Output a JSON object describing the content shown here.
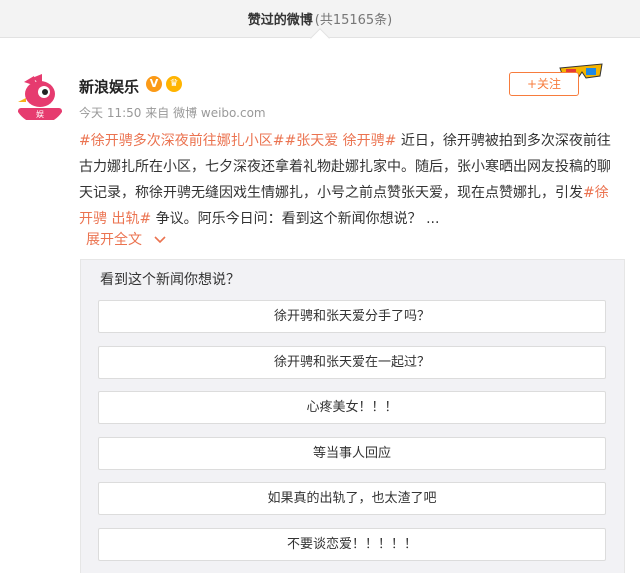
{
  "header": {
    "title": "赞过的微博",
    "count": "(共15165条)"
  },
  "post": {
    "author": "新浪娱乐",
    "verified_icon": "V",
    "time": "今天 11:50",
    "source_prefix": "来自",
    "source": "微博 weibo.com",
    "follow_label": "+关注",
    "topic1": "#徐开骋多次深夜前往娜扎小区#",
    "topic2": "#张天爱 徐开骋#",
    "text1": " 近日，徐开骋被拍到多次深夜前往古力娜扎所在小区，七夕深夜还拿着礼物赴娜扎家中。随后，张小寒晒出网友投稿的聊天记录，称徐开骋无缝因戏生情娜扎，小号之前点赞张天爱，现在点赞娜扎，引发",
    "topic3": "#徐开骋 出轨#",
    "text2": " 争议。阿乐今日问：看到这个新闻你想说？ ...",
    "expand_label": "展开全文",
    "expand_icon": "chevron-down-icon"
  },
  "poll": {
    "question": "看到这个新闻你想说？",
    "options": [
      "徐开骋和张天爱分手了吗？",
      "徐开骋和张天爱在一起过？",
      "心疼美女！！！",
      "等当事人回应",
      "如果真的出轨了，也太渣了吧",
      "不要谈恋爱！！！！！"
    ]
  },
  "colors": {
    "accent": "#eb7350",
    "follow": "#f77c3d",
    "background": "#f2f2f5"
  }
}
